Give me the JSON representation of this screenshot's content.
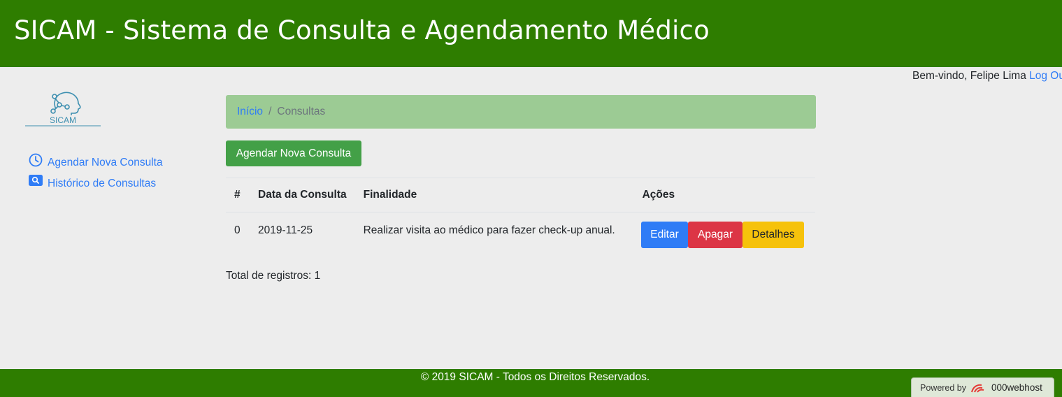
{
  "header": {
    "title": "SICAM - Sistema de Consulta e Agendamento Médico"
  },
  "user": {
    "welcome_text": "Bem-vindo, Felipe Lima",
    "logout_label": "Log Out"
  },
  "logo": {
    "text": "SICAM"
  },
  "sidebar": {
    "items": [
      {
        "label": "Agendar Nova Consulta",
        "icon": "clock-icon"
      },
      {
        "label": "Histórico de Consultas",
        "icon": "search-icon"
      }
    ]
  },
  "breadcrumb": {
    "home": "Início",
    "separator": "/",
    "current": "Consultas"
  },
  "actions": {
    "new_label": "Agendar Nova Consulta"
  },
  "table": {
    "headers": [
      "#",
      "Data da Consulta",
      "Finalidade",
      "Ações"
    ],
    "rows": [
      {
        "id": "0",
        "date": "2019-11-25",
        "purpose": "Realizar visita ao médico para fazer check-up anual."
      }
    ],
    "row_actions": {
      "edit": "Editar",
      "delete": "Apagar",
      "details": "Detalhes"
    }
  },
  "total": "Total de registros: 1",
  "footer": {
    "text": "© 2019 SICAM - Todos os Direitos Reservados."
  },
  "powered": {
    "prefix": "Powered by",
    "brand": "000webhost"
  },
  "colors": {
    "primary_green": "#2e7d00",
    "link_blue": "#2f7cf6",
    "danger": "#dc3545",
    "warning": "#f6c20b"
  }
}
